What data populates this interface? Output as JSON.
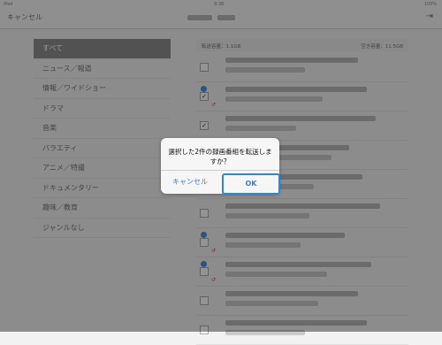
{
  "statusbar": {
    "device": "iPad",
    "time": "9:38",
    "battery": "100%"
  },
  "nav": {
    "cancel_label": "キャンセル"
  },
  "sidebar": {
    "items": [
      {
        "label": "すべて"
      },
      {
        "label": "ニュース／報道"
      },
      {
        "label": "情報／ワイドショー"
      },
      {
        "label": "ドラマ"
      },
      {
        "label": "音楽"
      },
      {
        "label": "バラエティ"
      },
      {
        "label": "アニメ／特撮"
      },
      {
        "label": "ドキュメンタリー"
      },
      {
        "label": "趣味／教育"
      },
      {
        "label": "ジャンルなし"
      }
    ]
  },
  "capacity": {
    "used": "転送容量：1.1GB",
    "free": "空き容量：11.5GB"
  },
  "list": {
    "rows": [
      {
        "checked": false,
        "new": false
      },
      {
        "checked": true,
        "new": true
      },
      {
        "checked": true,
        "new": false
      },
      {
        "checked": false,
        "new": false
      },
      {
        "checked": false,
        "new": true
      },
      {
        "checked": false,
        "new": false
      },
      {
        "checked": false,
        "new": true
      },
      {
        "checked": false,
        "new": true
      },
      {
        "checked": false,
        "new": false
      },
      {
        "checked": false,
        "new": false
      }
    ]
  },
  "dialog": {
    "message": "選択した2件の録画番組を転送しますか？",
    "cancel_label": "キャンセル",
    "ok_label": "OK"
  },
  "colors": {
    "accent": "#2a87d6",
    "selected_bg": "#8e8e8e"
  }
}
